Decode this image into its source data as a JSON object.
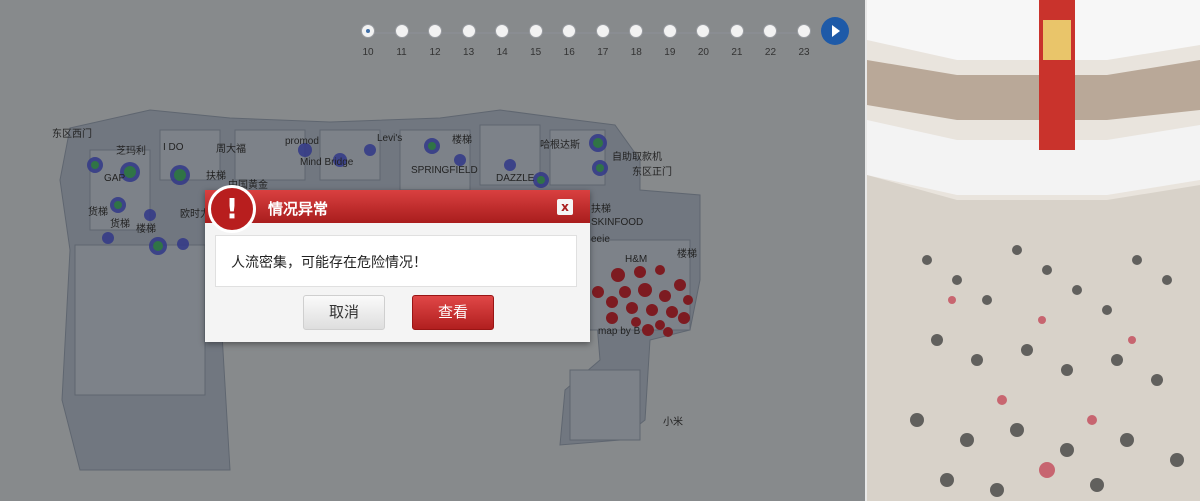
{
  "timeline": {
    "hours": [
      "10",
      "11",
      "12",
      "13",
      "14",
      "15",
      "16",
      "17",
      "18",
      "19",
      "20",
      "21",
      "22",
      "23"
    ],
    "selected": "10",
    "play_icon": "play-icon"
  },
  "map": {
    "labels": {
      "dongqu_ximen": "东区西门",
      "jiabaoli": "芝玛利",
      "ido": "I DO",
      "zhoudafu": "周大福",
      "promod": "promod",
      "levis": "Levi's",
      "louti_1": "楼梯",
      "hagen": "哈根达斯",
      "zidong_qukuanji": "自助取款机",
      "dongqu_zhengmen": "东区正门",
      "gap": "GAP",
      "futi_1": "扶梯",
      "zhongguo_huangjin": "中国黄金",
      "mind_bridge": "Mind Bridge",
      "springfield": "SPRINGFIELD",
      "dazzle": "DAZZLE",
      "huoti_1": "货梯",
      "oushida": "欧时力",
      "huoti_2": "货梯",
      "louti_2": "楼梯",
      "futi_2": "扶梯",
      "skinfood": "SKINFOOD",
      "eeie": "eeie",
      "hm": "H&M",
      "louti_3": "楼梯",
      "map_by_b": "map by B",
      "xiaomi": "小米"
    },
    "heat_colors": {
      "normal": "#35c24a",
      "medium": "#3a44d6",
      "danger": "#c4121d"
    }
  },
  "dialog": {
    "title": "情况异常",
    "message": "人流密集，可能存在危险情况！",
    "cancel_label": "取消",
    "view_label": "查看",
    "close_label": "x",
    "alert_glyph": "!"
  }
}
